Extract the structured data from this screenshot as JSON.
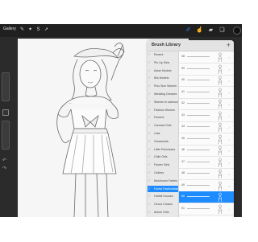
{
  "toolbar": {
    "gallery_label": "Gallery",
    "left_tools": [
      "wrench-icon",
      "magic-wand-icon",
      "selection-icon",
      "transform-icon"
    ],
    "right_tools": [
      "brush-icon",
      "smudge-icon",
      "eraser-icon",
      "layers-icon"
    ],
    "current_color": "#111111"
  },
  "panel": {
    "title": "Brush Library",
    "add_label": "+",
    "categories": [
      "Recent",
      "Pin Up Girls",
      "Asian Models",
      "80s Models",
      "Plus Size Women",
      "Wedding Dresses",
      "Women in swimsuits",
      "Fashion Women",
      "Flowers",
      "Carnival Girls",
      "Cats",
      "Ornaments",
      "Little Princesses",
      "Chibi Girls",
      "Flower Girls",
      "Clothes",
      "Mushroom Fairies",
      "Forest Fashionistas",
      "Hobbit Houses",
      "Circus Clowns",
      "Anime Girls"
    ],
    "selected_category": "Forest Fashionistas",
    "brushes": [
      {
        "num": "38"
      },
      {
        "num": "39"
      },
      {
        "num": "40"
      },
      {
        "num": "41"
      },
      {
        "num": "42"
      },
      {
        "num": "43"
      },
      {
        "num": "44"
      },
      {
        "num": "45"
      },
      {
        "num": "46"
      },
      {
        "num": "47"
      },
      {
        "num": "48"
      },
      {
        "num": "49"
      },
      {
        "num": "50"
      },
      {
        "num": "51"
      }
    ],
    "selected_brush_index": 12
  },
  "colors": {
    "accent": "#1e8cff",
    "screen": "#2b2b2b",
    "panel": "#f2f2f2"
  }
}
